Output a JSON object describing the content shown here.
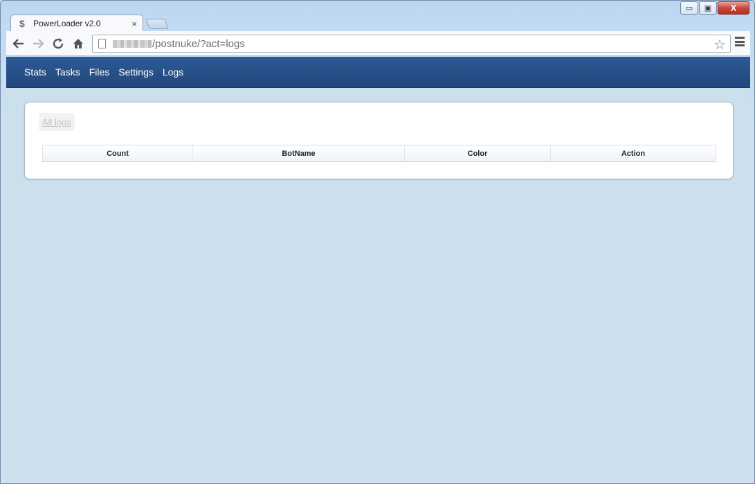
{
  "window": {
    "minimize_glyph": "▭",
    "maximize_glyph": "▣",
    "close_glyph": "X"
  },
  "tab": {
    "favicon": "$",
    "title": "PowerLoader v2.0",
    "close": "×"
  },
  "toolbar": {
    "back_icon": "back-arrow-icon",
    "forward_icon": "forward-arrow-icon",
    "reload_icon": "reload-icon",
    "home_icon": "home-icon",
    "url": "/postnuke/?act=logs",
    "star_glyph": "☆"
  },
  "navbar": {
    "items": [
      "Stats",
      "Tasks",
      "Files",
      "Settings",
      "Logs"
    ]
  },
  "panel": {
    "all_logs_link": "All logs",
    "table": {
      "columns": [
        "Count",
        "BotName",
        "Color",
        "Action"
      ],
      "rows": []
    }
  },
  "colors": {
    "navbar": "#2a518b",
    "page_background": "#cbe0ec"
  }
}
